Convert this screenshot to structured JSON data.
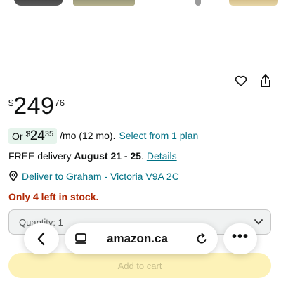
{
  "price": {
    "currency_symbol": "$",
    "whole": "249",
    "fraction": "76"
  },
  "monthly": {
    "prefix": "Or",
    "currency_symbol": "$",
    "whole": "24",
    "fraction": "35",
    "suffix": "/mo (12 mo).",
    "link": "Select from 1 plan"
  },
  "delivery": {
    "prefix": "FREE delivery ",
    "dates": "August 21 - 25",
    "separator": ". ",
    "link": "Details"
  },
  "deliver_to": {
    "text": "Deliver to Graham - Victoria V9A 2C"
  },
  "stock": {
    "text": "Only 4 left in stock."
  },
  "quantity": {
    "label": "Quantity: 1"
  },
  "add_to_cart": {
    "label": "Add to cart"
  },
  "browser": {
    "url": "amazon.ca",
    "more": "•••"
  },
  "icons": {
    "heart": "heart-icon",
    "share": "share-icon",
    "pin": "location-pin-icon",
    "chevron": "chevron-down-icon",
    "back": "chevron-left-icon",
    "tabs": "tabs-icon",
    "reload": "reload-icon"
  },
  "colors": {
    "link": "#007185",
    "stock_red": "#b12704",
    "monthly_badge": "#e6f4ec",
    "add_to_cart": "#fdf2b8"
  }
}
